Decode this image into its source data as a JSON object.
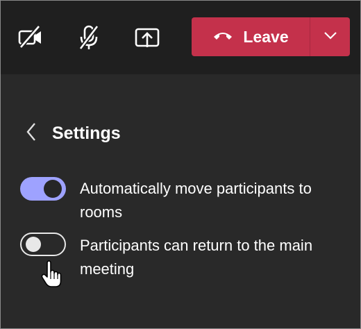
{
  "toolbar": {
    "camera_icon": "camera-off-icon",
    "mic_icon": "mic-off-icon",
    "share_icon": "share-screen-icon",
    "leave_label": "Leave",
    "leave_icon": "phone-hangup-icon",
    "leave_caret_icon": "chevron-down-icon"
  },
  "settings": {
    "title": "Settings",
    "back_icon": "chevron-left-icon",
    "options": [
      {
        "label": "Automatically move participants to rooms",
        "enabled": true
      },
      {
        "label": "Participants can return to the main meeting",
        "enabled": false
      }
    ]
  },
  "colors": {
    "toolbar_bg": "#1f1f1f",
    "panel_bg": "#292929",
    "leave_red": "#c4314b",
    "toggle_on": "#9ea2ff",
    "text": "#ffffff"
  }
}
